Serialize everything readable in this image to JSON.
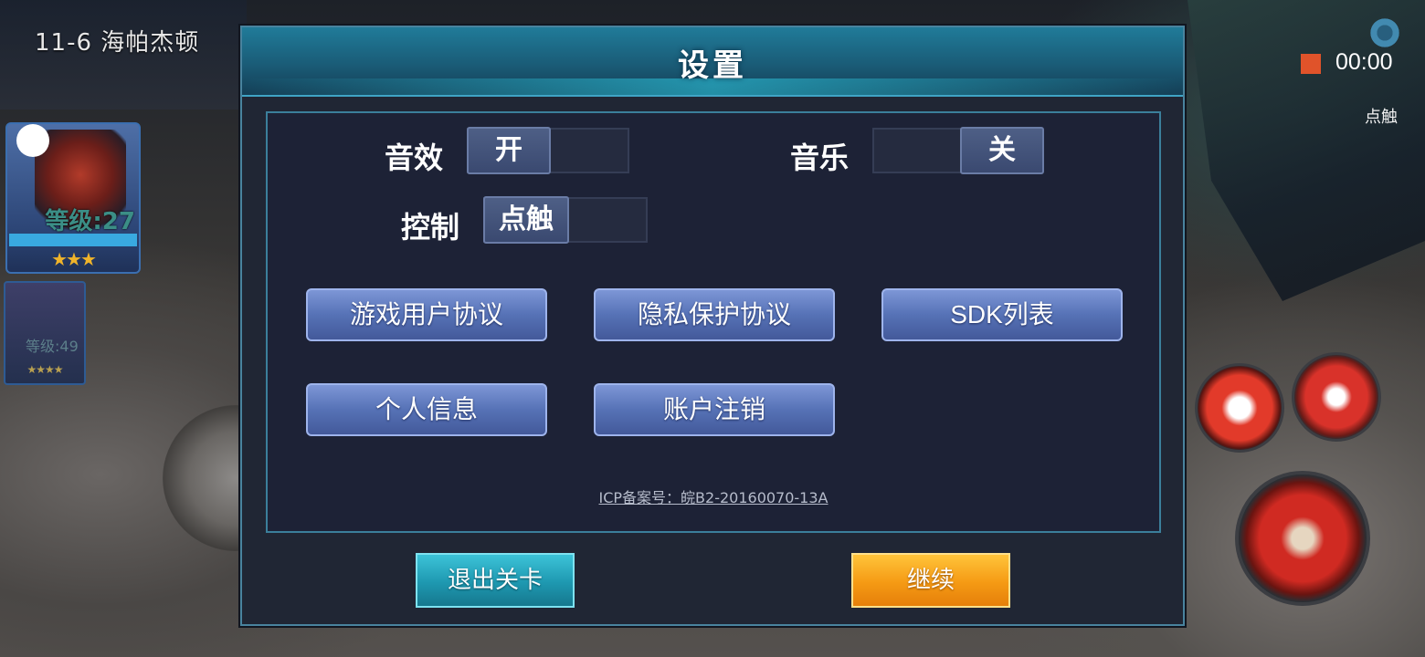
{
  "hud": {
    "level_name": "11-6  海帕杰顿",
    "hero1": {
      "level": "等级:27",
      "stars": "★★★"
    },
    "hero2": {
      "level": "等级:49",
      "stars": "★★★★"
    },
    "record_time": "00:00",
    "touch_label": "点触"
  },
  "dialog": {
    "title": "设置",
    "sound": {
      "label": "音效",
      "state": "开"
    },
    "music": {
      "label": "音乐",
      "state": "关"
    },
    "control": {
      "label": "控制",
      "state": "点触"
    },
    "buttons": [
      "游戏用户协议",
      "隐私保护协议",
      "SDK列表",
      "个人信息",
      "账户注销"
    ],
    "icp": "ICP备案号：皖B2-20160070-13A",
    "exit_label": "退出关卡",
    "continue_label": "继续"
  },
  "colors": {
    "accent_teal": "#207b99",
    "button_blue": "#5672b6",
    "continue_orange": "#f59a14",
    "record_red": "#e0532a"
  }
}
